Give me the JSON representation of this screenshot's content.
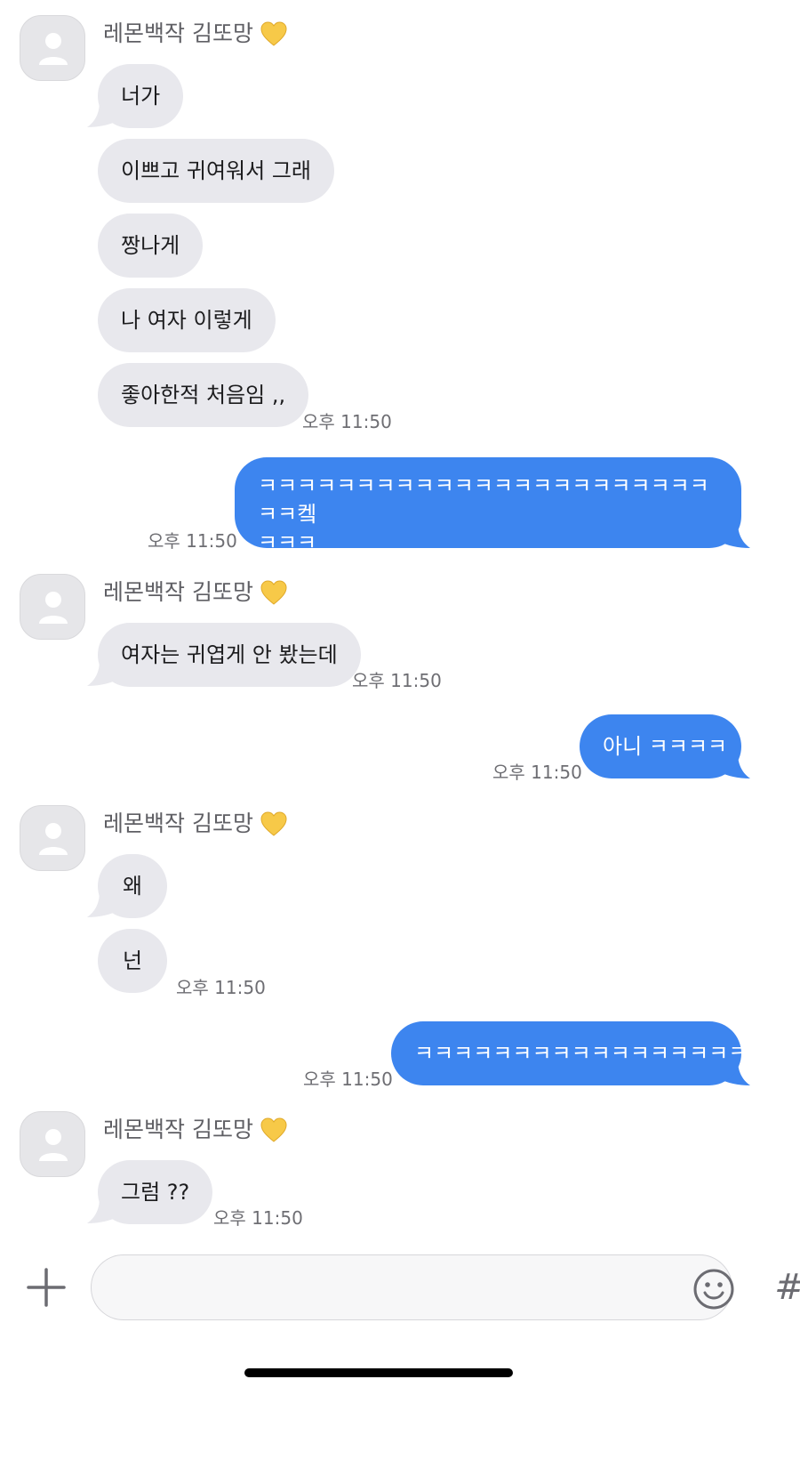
{
  "sender_name": "레몬백작 김또망",
  "messages": {
    "m1": "너가",
    "m2": "이쁘고 귀여워서 그래",
    "m3": "짱나게",
    "m4": "나 여자 이렇게",
    "m5": "좋아한적 처음임 ,,",
    "m6_line1": "ㅋㅋㅋㅋㅋㅋㅋㅋㅋㅋㅋㅋㅋㅋㅋㅋㅋㅋㅋㅋㅋㅋㅋㅋㅋ켘",
    "m6_line2": "ㅋㅋㅋ",
    "m7": "여자는 귀엽게 안 봤는데",
    "m8": "아니 ㅋㅋㅋㅋ",
    "m9": "왜",
    "m10": "넌",
    "m11": "ㅋㅋㅋㅋㅋㅋㅋㅋㅋㅋㅋㅋㅋㅋㅋㅋㅋ",
    "m12": "그럼 ??"
  },
  "timestamp": "오후 11:50",
  "composer": {
    "placeholder": "",
    "hash_label": "#"
  },
  "colors": {
    "incoming_bubble": "#e8e8ed",
    "outgoing_bubble": "#3d85ef",
    "heart": "#f7c948"
  },
  "icons": {
    "avatar": "person-icon",
    "heart": "yellow-heart-icon",
    "plus": "plus-icon",
    "emoji": "smiley-icon",
    "hash": "hashtag-icon"
  }
}
